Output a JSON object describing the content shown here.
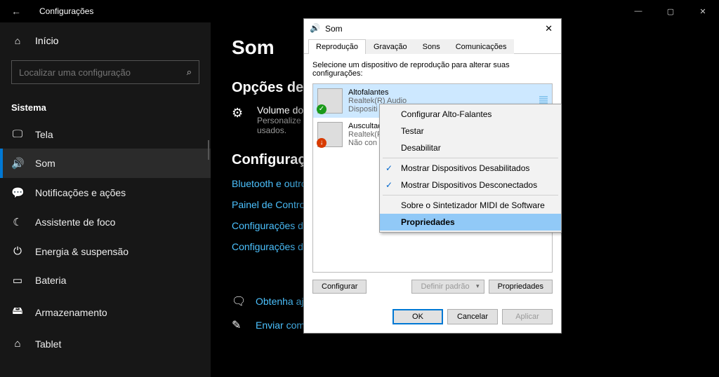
{
  "window": {
    "title": "Configurações",
    "minimize": "—",
    "maximize": "▢",
    "close": "✕"
  },
  "sidebar": {
    "home": "Início",
    "search_placeholder": "Localizar uma configuração",
    "category": "Sistema",
    "items": [
      {
        "icon": "🖵",
        "label": "Tela"
      },
      {
        "icon": "🔊",
        "label": "Som"
      },
      {
        "icon": "💬",
        "label": "Notificações e ações"
      },
      {
        "icon": "☾",
        "label": "Assistente de foco"
      },
      {
        "icon": "⏻",
        "label": "Energia & suspensão"
      },
      {
        "icon": "▭",
        "label": "Bateria"
      },
      {
        "icon": "🖴",
        "label": "Armazenamento"
      },
      {
        "icon": "⌂",
        "label": "Tablet"
      }
    ]
  },
  "main": {
    "heading": "Som",
    "section1": "Opções de so",
    "vol_label": "Volume do",
    "vol_sub": "Personalize",
    "vol_sub2": "usados.",
    "section2": "Configuraçõe",
    "links": [
      "Bluetooth e outros",
      "Painel de Controle",
      "Configurações de p",
      "Configurações de a"
    ],
    "help": "Obtenha ajuda",
    "feedback": "Enviar comentários"
  },
  "dialog": {
    "title": "Som",
    "tabs": [
      "Reprodução",
      "Gravação",
      "Sons",
      "Comunicações"
    ],
    "instruction": "Selecione um dispositivo de reprodução para alterar suas configurações:",
    "devices": [
      {
        "name": "Altofalantes",
        "sub1": "Realtek(R) Audio",
        "sub2": "Dispositi"
      },
      {
        "name": "Auscultad",
        "sub1": "Realtek(R",
        "sub2": "Não con"
      }
    ],
    "btn_config": "Configurar",
    "btn_default": "Definir padrão",
    "btn_props": "Propriedades",
    "btn_ok": "OK",
    "btn_cancel": "Cancelar",
    "btn_apply": "Aplicar"
  },
  "ctx": {
    "items": [
      {
        "label": "Configurar Alto-Falantes"
      },
      {
        "label": "Testar"
      },
      {
        "label": "Desabilitar"
      },
      {
        "sep": true
      },
      {
        "label": "Mostrar Dispositivos Desabilitados",
        "checked": true
      },
      {
        "label": "Mostrar Dispositivos Desconectados",
        "checked": true
      },
      {
        "sep": true
      },
      {
        "label": "Sobre o Sintetizador MIDI de Software"
      },
      {
        "label": "Propriedades",
        "hl": true
      }
    ]
  }
}
